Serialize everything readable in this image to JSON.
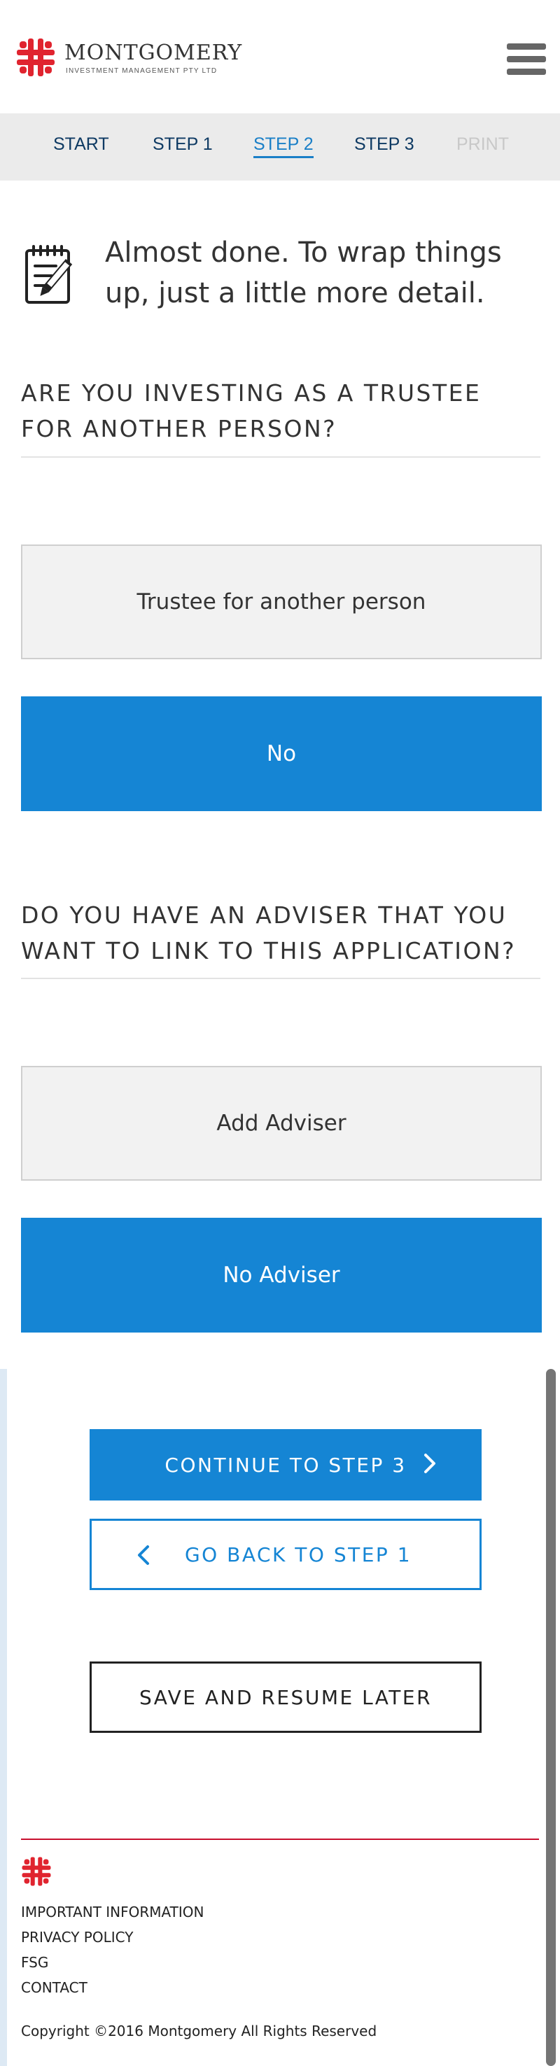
{
  "header": {
    "brand_name": "Montgomery",
    "brand_sub": "INVESTMENT MANAGEMENT PTY LTD",
    "brand_color": "#e0242f",
    "menu_icon": "hamburger-menu-icon"
  },
  "steps": [
    {
      "label": "START",
      "state": "default"
    },
    {
      "label": "STEP 1",
      "state": "default"
    },
    {
      "label": "STEP 2",
      "state": "active"
    },
    {
      "label": "STEP 3",
      "state": "default"
    },
    {
      "label": "PRINT",
      "state": "disabled"
    }
  ],
  "intro": {
    "icon": "notepad-pencil-icon",
    "text": "Almost done. To wrap things up, just a little more detail."
  },
  "trustee_question": {
    "heading": "ARE YOU INVESTING AS A TRUSTEE FOR ANOTHER PERSON?",
    "options": [
      {
        "label": "Trustee for another person",
        "selected": false
      },
      {
        "label": "No",
        "selected": true
      }
    ]
  },
  "adviser_question": {
    "heading": "DO YOU HAVE AN ADVISER THAT YOU WANT TO LINK TO THIS APPLICATION?",
    "options": [
      {
        "label": "Add Adviser",
        "selected": false
      },
      {
        "label": "No Adviser",
        "selected": true
      }
    ]
  },
  "actions": {
    "continue_label": "CONTINUE TO STEP 3",
    "back_label": "GO BACK TO STEP 1",
    "save_label": "SAVE AND RESUME LATER"
  },
  "footer": {
    "links": [
      "IMPORTANT INFORMATION",
      "PRIVACY POLICY",
      "FSG",
      "CONTACT"
    ],
    "copyright": "Copyright ©2016 Montgomery All Rights Reserved"
  },
  "colors": {
    "accent": "#1585d4",
    "active_step": "#1a7fc7",
    "nav_text": "#0e3a63",
    "footer_rule": "#c8102e"
  }
}
